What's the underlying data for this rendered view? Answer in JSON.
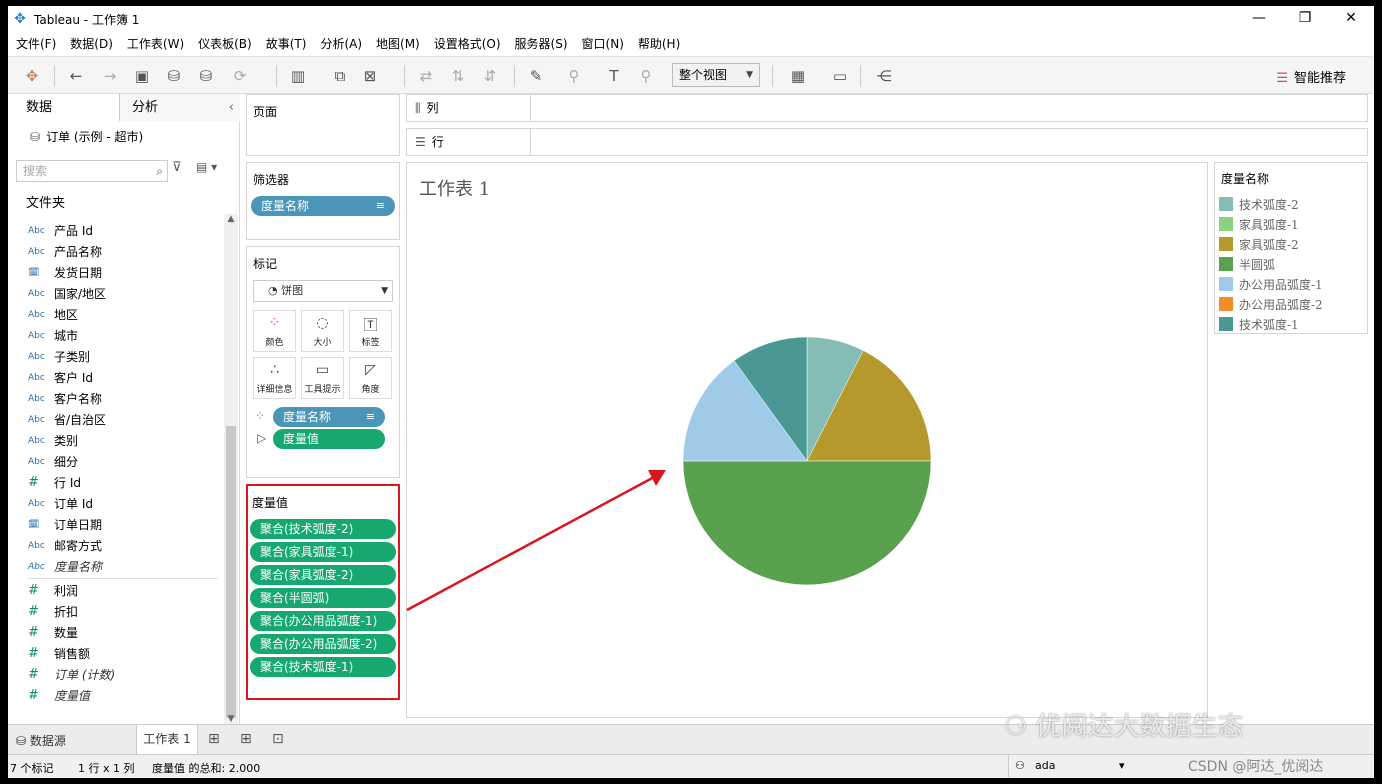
{
  "window": {
    "title": "Tableau - 工作簿 1",
    "controls": [
      "—",
      "❐",
      "✕"
    ]
  },
  "menu": [
    "文件(F)",
    "数据(D)",
    "工作表(W)",
    "仪表板(B)",
    "故事(T)",
    "分析(A)",
    "地图(M)",
    "设置格式(O)",
    "服务器(S)",
    "窗口(N)",
    "帮助(H)"
  ],
  "toolbar": {
    "fit_label": "整个视图",
    "smart_label": "智能推荐"
  },
  "data_pane": {
    "tab_data": "数据",
    "tab_analysis": "分析",
    "datasource": "订单 (示例 - 超市)",
    "search_placeholder": "搜索",
    "folder_header": "文件夹",
    "dimensions": [
      {
        "type": "Abc",
        "name": "产品 Id"
      },
      {
        "type": "Abc",
        "name": "产品名称"
      },
      {
        "type": "date",
        "name": "发货日期"
      },
      {
        "type": "Abc",
        "name": "国家/地区"
      },
      {
        "type": "Abc",
        "name": "地区"
      },
      {
        "type": "Abc",
        "name": "城市"
      },
      {
        "type": "Abc",
        "name": "子类别"
      },
      {
        "type": "Abc",
        "name": "客户 Id"
      },
      {
        "type": "Abc",
        "name": "客户名称"
      },
      {
        "type": "Abc",
        "name": "省/自治区"
      },
      {
        "type": "Abc",
        "name": "类别"
      },
      {
        "type": "Abc",
        "name": "细分"
      },
      {
        "type": "#",
        "name": "行 Id"
      },
      {
        "type": "Abc",
        "name": "订单 Id"
      },
      {
        "type": "date",
        "name": "订单日期"
      },
      {
        "type": "Abc",
        "name": "邮寄方式"
      },
      {
        "type": "Abc",
        "name": "度量名称",
        "italic": true
      }
    ],
    "measures": [
      {
        "type": "#",
        "name": "利润"
      },
      {
        "type": "#",
        "name": "折扣"
      },
      {
        "type": "#",
        "name": "数量"
      },
      {
        "type": "#",
        "name": "销售额"
      },
      {
        "type": "#",
        "name": "订单 (计数)",
        "italic": true
      },
      {
        "type": "#",
        "name": "度量值",
        "italic": true
      }
    ]
  },
  "cards": {
    "pages_title": "页面",
    "filters_title": "筛选器",
    "filter_pill": "度量名称",
    "marks_title": "标记",
    "mark_type": "饼图",
    "mark_buttons": [
      "颜色",
      "大小",
      "标签",
      "详细信息",
      "工具提示",
      "角度"
    ],
    "mark_pills": [
      "度量名称",
      "度量值"
    ],
    "measure_values_title": "度量值",
    "measure_values": [
      "聚合(技术弧度-2)",
      "聚合(家具弧度-1)",
      "聚合(家具弧度-2)",
      "聚合(半圆弧)",
      "聚合(办公用品弧度-1)",
      "聚合(办公用品弧度-2)",
      "聚合(技术弧度-1)"
    ]
  },
  "shelves": {
    "columns": "列",
    "rows": "行"
  },
  "view": {
    "title": "工作表 1"
  },
  "legend": {
    "title": "度量名称",
    "items": [
      {
        "label": "技术弧度-2",
        "color": "#86bcb6"
      },
      {
        "label": "家具弧度-1",
        "color": "#8cd17d"
      },
      {
        "label": "家具弧度-2",
        "color": "#b6992d"
      },
      {
        "label": "半圆弧",
        "color": "#59a14f"
      },
      {
        "label": "办公用品弧度-1",
        "color": "#a0cbe8"
      },
      {
        "label": "办公用品弧度-2",
        "color": "#f28e2b"
      },
      {
        "label": "技术弧度-1",
        "color": "#499894"
      }
    ]
  },
  "chart_data": {
    "type": "pie",
    "slices": [
      {
        "label": "技术弧度-2",
        "value": 0.15,
        "color": "#86bcb6"
      },
      {
        "label": "家具弧度-2",
        "value": 0.35,
        "color": "#b6992d"
      },
      {
        "label": "半圆弧",
        "value": 1.0,
        "color": "#59a14f"
      },
      {
        "label": "办公用品弧度-1",
        "value": 0.3,
        "color": "#a0cbe8"
      },
      {
        "label": "技术弧度-1",
        "value": 0.2,
        "color": "#499894"
      }
    ],
    "total": 2.0
  },
  "bottom": {
    "datasource_tab": "数据源",
    "sheet_tab": "工作表 1"
  },
  "status": {
    "marks": "7 个标记",
    "rows_cols": "1 行 x 1 列",
    "sum": "度量值 的总和: 2.000",
    "user": "ada"
  },
  "watermark": "优阅达大数据生态",
  "credit": "CSDN @阿达_优阅达"
}
